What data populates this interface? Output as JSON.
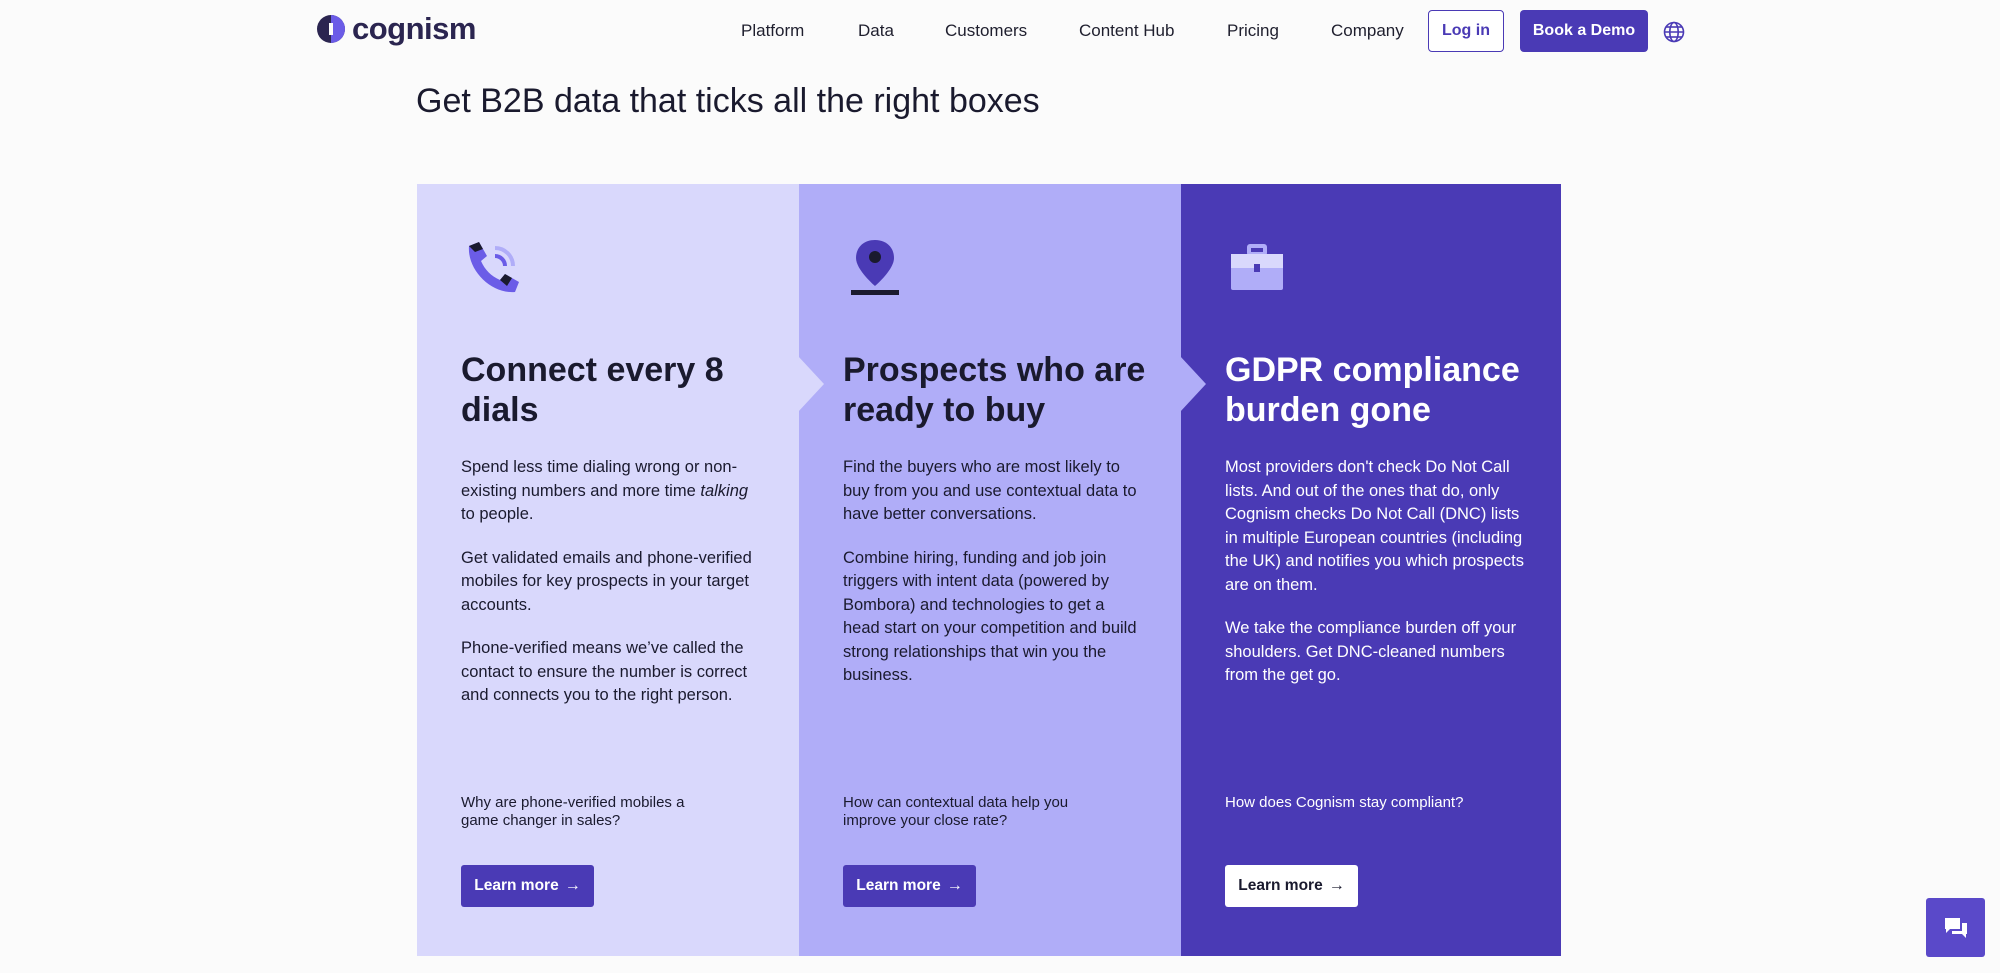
{
  "header": {
    "logo_text": "cognism",
    "nav": [
      "Platform",
      "Data",
      "Customers",
      "Content Hub",
      "Pricing",
      "Company"
    ],
    "login_label": "Log in",
    "demo_label": "Book a Demo",
    "globe_icon": "globe-icon"
  },
  "page": {
    "title": "Get B2B data that ticks all the right boxes"
  },
  "columns": [
    {
      "icon": "phone-icon",
      "title": "Connect every 8 dials",
      "para1_pre": "Spend less time dialing wrong or non-existing numbers and more time ",
      "para1_em": "talking",
      "para1_post": " to people.",
      "para2": "Get validated emails and phone-verified mobiles for key prospects in your target accounts.",
      "para3": "Phone-verified means we’ve called the contact to ensure the number is correct and connects you to the right person.",
      "question": "Why are phone-verified mobiles a game changer in sales?",
      "button": "Learn more"
    },
    {
      "icon": "map-pin-icon",
      "title": "Prospects who are ready to buy",
      "para1": "Find the buyers who are most likely to buy from you and use contextual data to have better conversations.",
      "para2": "Combine hiring, funding and job join triggers with intent data (powered by Bombora) and technologies to get a head start on your competition and build strong relationships that win you the business.",
      "question": "How can contextual data help you improve your close rate?",
      "button": "Learn more"
    },
    {
      "icon": "briefcase-icon",
      "title": "GDPR compliance burden gone",
      "para1": "Most providers don't check Do Not Call lists. And out of the ones that do, only Cognism checks Do Not Call (DNC) lists in multiple European countries (including the UK) and notifies you which prospects are on them.",
      "para2": "We take the compliance burden off your shoulders. Get DNC-cleaned numbers from the get go.",
      "question": "How does Cognism stay compliant?",
      "button": "Learn more"
    }
  ],
  "chat": {
    "icon": "chat-icon"
  },
  "colors": {
    "accent": "#4a3ab5",
    "col1_bg": "#d9d8fc",
    "col2_bg": "#b0adf8",
    "col3_bg": "#4a3ab5"
  }
}
